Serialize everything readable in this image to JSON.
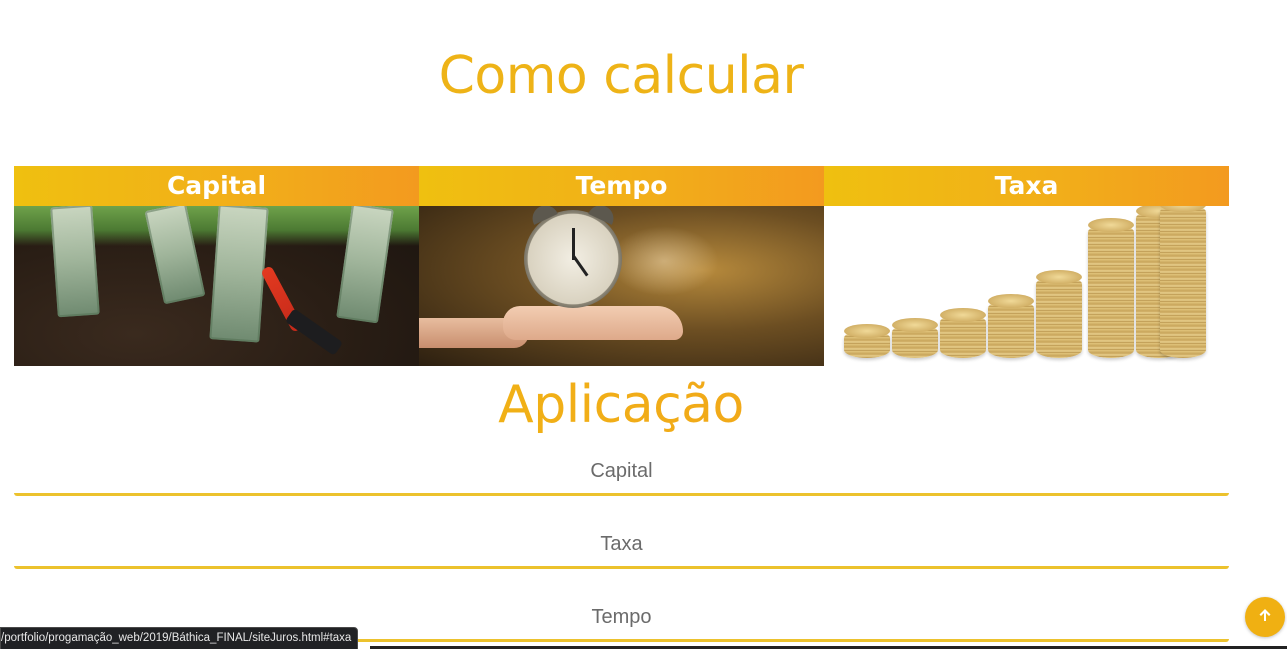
{
  "main": {
    "title": "Como calcular",
    "cards": [
      {
        "label": "Capital",
        "image": "money-in-soil-photo"
      },
      {
        "label": "Tempo",
        "image": "alarm-clock-on-hand-photo"
      },
      {
        "label": "Taxa",
        "image": "gold-coin-stacks-photo"
      }
    ]
  },
  "aplicacao": {
    "title": "Aplicação",
    "fields": [
      {
        "placeholder": "Capital"
      },
      {
        "placeholder": "Taxa"
      },
      {
        "placeholder": "Tempo"
      }
    ]
  },
  "status_bar": {
    "url": "/portfolio/progamação_web/2019/Báthica_FINAL/siteJuros.html#taxa"
  },
  "scroll_top": {
    "icon": "arrow-up-icon"
  },
  "colors": {
    "accent": "#eeb317",
    "accent_end": "#f39a1f",
    "field_underline": "#ecc22d"
  }
}
